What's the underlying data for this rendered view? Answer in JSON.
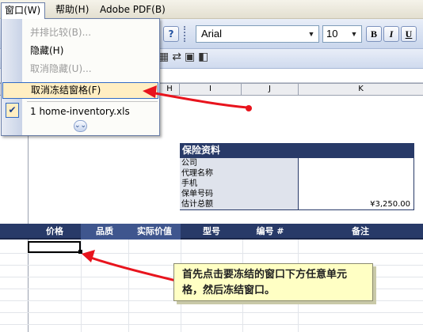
{
  "menubar": {
    "window": "窗口(W)",
    "help": "帮助(H)",
    "pdf": "Adobe PDF(B)"
  },
  "toolbar": {
    "help_icon": "?",
    "font": "Arial",
    "size": "10",
    "bold": "B",
    "italic": "I",
    "underline": "U"
  },
  "window_menu": {
    "items": [
      {
        "label": "并排比较(B)...",
        "disabled": true
      },
      {
        "label": "隐藏(H)",
        "disabled": false
      },
      {
        "label": "取消隐藏(U)...",
        "disabled": true
      },
      {
        "label": "取消冻结窗格(F)",
        "highlighted": true
      },
      {
        "label": "1 home-inventory.xls",
        "checked": true
      }
    ],
    "expand_icon": "chevron-double-down-icon"
  },
  "columns": [
    "H",
    "I",
    "J",
    "K"
  ],
  "insurance": {
    "title": "保险资料",
    "rows": [
      {
        "label": "公司",
        "value": ""
      },
      {
        "label": "代理名称",
        "value": ""
      },
      {
        "label": "手机",
        "value": ""
      },
      {
        "label": "保单号码",
        "value": ""
      },
      {
        "label": "估计总额",
        "value": "¥3,250.00"
      }
    ]
  },
  "header_band": [
    "价格",
    "品质",
    "实际价值",
    "型号",
    "编号 #",
    "备注"
  ],
  "callout": "首先点击要冻结的窗口下方任意单元格，然后冻结窗口。",
  "colors": {
    "header_navy": "#283a68",
    "highlight": "#ffeec2",
    "arrow_red": "#e8141d",
    "callout_bg": "#ffffc4"
  }
}
